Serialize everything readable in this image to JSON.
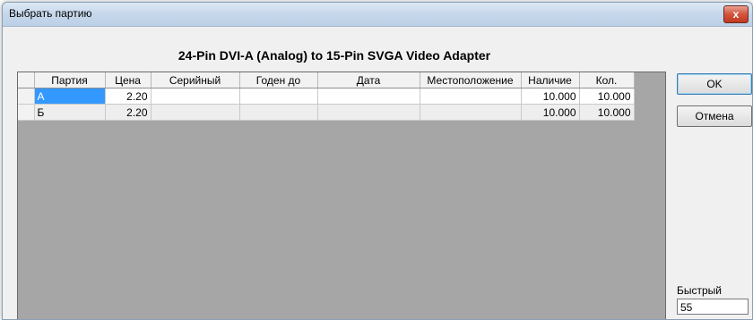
{
  "window": {
    "title": "Выбрать партию",
    "close_symbol": "x"
  },
  "product_title": "24-Pin DVI-A (Analog) to 15-Pin SVGA Video Adapter",
  "table": {
    "headers": [
      "Партия",
      "Цена",
      "Серийный",
      "Годен до",
      "Дата",
      "Местоположение",
      "Наличие",
      "Кол."
    ],
    "rows": [
      [
        "А",
        "2.20",
        "",
        "",
        "",
        "",
        "10.000",
        "10.000"
      ],
      [
        "Б",
        "2.20",
        "",
        "",
        "",
        "",
        "10.000",
        "10.000"
      ]
    ],
    "selected_row": 0,
    "selection_color": "#3399ff"
  },
  "buttons": {
    "ok": "OK",
    "cancel": "Отмена"
  },
  "quick": {
    "label": "Быстрый",
    "value": "55"
  }
}
